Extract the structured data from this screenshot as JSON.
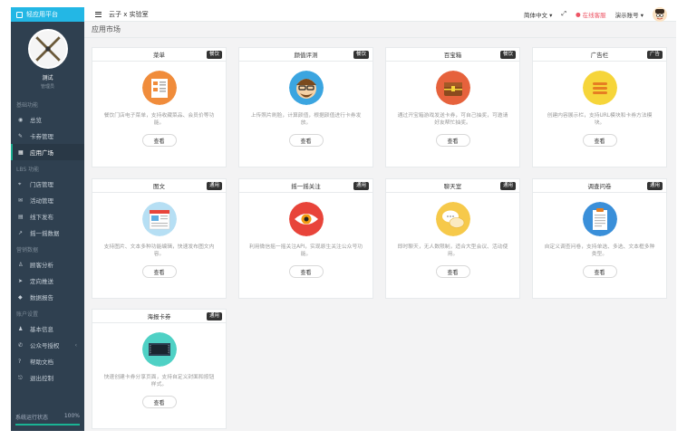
{
  "sidebar": {
    "brand": "轻应用平台",
    "profile": {
      "name": "测试",
      "role": "管理员"
    },
    "sections": [
      {
        "title": "基础功能",
        "items": [
          {
            "label": "总览",
            "icon": "dashboard-icon"
          },
          {
            "label": "卡券管理",
            "icon": "coupon-icon"
          },
          {
            "label": "应用广场",
            "icon": "grid-icon",
            "active": true
          }
        ]
      },
      {
        "title": "LBS 功能",
        "items": [
          {
            "label": "门店管理",
            "icon": "location-icon"
          },
          {
            "label": "活动管理",
            "icon": "megaphone-icon"
          },
          {
            "label": "线下发布",
            "icon": "list-icon"
          },
          {
            "label": "摇一摇数据",
            "icon": "chart-icon"
          }
        ]
      },
      {
        "title": "营销数据",
        "items": [
          {
            "label": "顾客分析",
            "icon": "user-icon"
          },
          {
            "label": "定向推送",
            "icon": "send-icon"
          },
          {
            "label": "数据报告",
            "icon": "diamond-icon"
          }
        ]
      },
      {
        "title": "账户设置",
        "items": [
          {
            "label": "基本信息",
            "icon": "person-icon"
          },
          {
            "label": "公众号授权",
            "icon": "wechat-icon",
            "arrow": "‹"
          },
          {
            "label": "帮助文档",
            "icon": "help-icon"
          },
          {
            "label": "退出控制",
            "icon": "logout-icon"
          }
        ]
      }
    ],
    "status": {
      "label": "系统运行状态",
      "value": "100%"
    }
  },
  "header": {
    "breadcrumb": "云子 x 实验室",
    "language": "简体中文",
    "service": "在线客服",
    "account": "演示账号"
  },
  "page": {
    "title": "应用市场"
  },
  "cards": [
    {
      "title": "菜单",
      "badge": "餐饮",
      "desc": "餐饮门店电子菜单，支持收藏菜品、会员价等功能。",
      "button": "查看",
      "icon": "menu-icon",
      "color": "#f08c3b"
    },
    {
      "title": "颜值评测",
      "badge": "餐饮",
      "desc": "上传照片刷脸，计算颜值，根据颜值进行卡券发放。",
      "button": "查看",
      "icon": "face-icon",
      "color": "#3ba5e0"
    },
    {
      "title": "百宝箱",
      "badge": "餐饮",
      "desc": "通过开宝箱游戏发送卡券，可自己抽奖，可邀请好友帮忙抽奖。",
      "button": "查看",
      "icon": "treasure-icon",
      "color": "#e6623c"
    },
    {
      "title": "广告栏",
      "badge": "广告",
      "desc": "创建内容展示栏，支持URL模块和卡券方法模块。",
      "button": "查看",
      "icon": "ad-icon",
      "color": "#f6d53a"
    },
    {
      "title": "图文",
      "badge": "通用",
      "desc": "支持图片、文本多种功能编辑，快速发布图文内容。",
      "button": "查看",
      "icon": "article-icon",
      "color": "#b6dff4"
    },
    {
      "title": "摇一摇关注",
      "badge": "通用",
      "desc": "利用微信摇一摇关注API，实现原生关注公众号功能。",
      "button": "查看",
      "icon": "eye-icon",
      "color": "#e8443a"
    },
    {
      "title": "聊天室",
      "badge": "通用",
      "desc": "即时聊天，无人数限制，适合大型会议、活动使用。",
      "button": "查看",
      "icon": "chat-icon",
      "color": "#f6c94a"
    },
    {
      "title": "调查问卷",
      "badge": "通用",
      "desc": "自定义调查问卷，支持单选、多选、文本框多种类型。",
      "button": "查看",
      "icon": "survey-icon",
      "color": "#3a8fd9"
    },
    {
      "title": "海报卡券",
      "badge": "通用",
      "desc": "快速创建卡券分享页面，支持自定义封面和按钮样式。",
      "button": "查看",
      "icon": "poster-icon",
      "color": "#4fd1c5"
    }
  ]
}
